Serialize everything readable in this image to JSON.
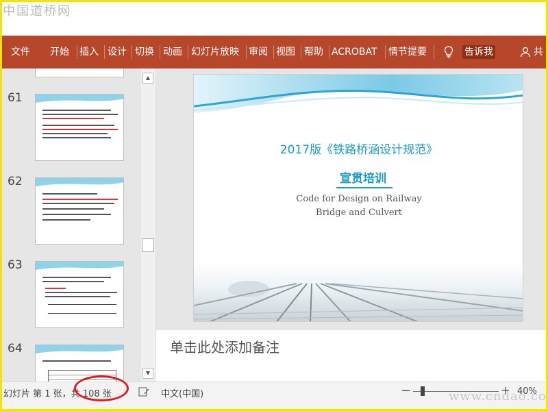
{
  "watermark": {
    "top": "中国道桥网",
    "bottom": "www.cndao.com"
  },
  "ribbon": {
    "tabs": [
      "文件",
      "开始",
      "插入",
      "设计",
      "切换",
      "动画",
      "幻灯片放映",
      "审阅",
      "视图",
      "帮助",
      "ACROBAT",
      "情节提要"
    ],
    "tell_me": "告诉我",
    "share": "共",
    "background": "#b7472a"
  },
  "thumbnails": [
    {
      "number": "61"
    },
    {
      "number": "62"
    },
    {
      "number": "63"
    },
    {
      "number": "64"
    }
  ],
  "slide": {
    "title": "2017版《铁路桥涵设计规范》",
    "subtitle": "宣贯培训",
    "english_line1": "Code for Design on Railway",
    "english_line2": "Bridge and Culvert",
    "accent": "#1a9bc7"
  },
  "notes": {
    "placeholder": "单击此处添加备注"
  },
  "statusbar": {
    "slide_count": "幻灯片 第 1 张，共 108 张",
    "language": "中文(中国)",
    "zoom_minus": "−",
    "zoom_plus": "+",
    "zoom": "40%",
    "zoom_percent": 40
  },
  "annotation_color": "#e01b1b"
}
